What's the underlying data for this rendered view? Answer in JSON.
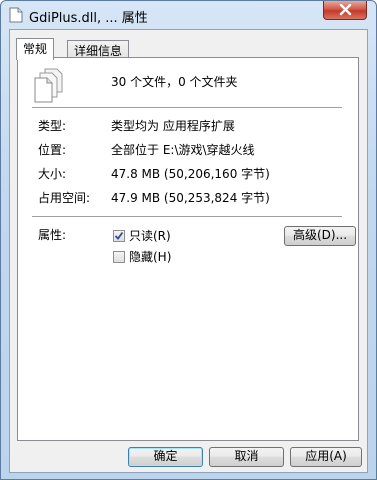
{
  "window": {
    "title": "GdiPlus.dll, ... 属性"
  },
  "tabs": [
    {
      "label": "常规",
      "active": true
    },
    {
      "label": "详细信息",
      "active": false
    }
  ],
  "general": {
    "summary": "30 个文件，0 个文件夹",
    "type_label": "类型:",
    "type_value": "类型均为 应用程序扩展",
    "location_label": "位置:",
    "location_value": "全部位于 E:\\游戏\\穿越火线",
    "size_label": "大小:",
    "size_value": "47.8 MB (50,206,160 字节)",
    "disk_label": "占用空间:",
    "disk_value": "47.9 MB (50,253,824 字节)",
    "attributes_label": "属性:",
    "readonly_label": "只读(R)",
    "readonly_checked": true,
    "hidden_label": "隐藏(H)",
    "hidden_checked": false,
    "advanced_label": "高级(D)..."
  },
  "buttons": {
    "ok": "确定",
    "cancel": "取消",
    "apply": "应用(A)"
  },
  "icons": {
    "title": "file-icon",
    "summary": "multiple-files-icon",
    "close": "close-icon"
  }
}
